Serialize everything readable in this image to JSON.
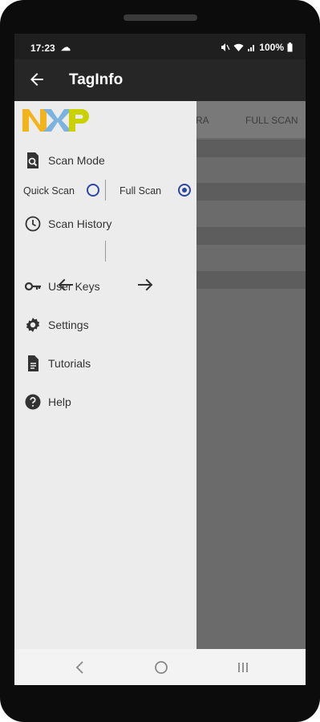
{
  "status_bar": {
    "time": "17:23",
    "battery": "100%",
    "icons": [
      "cloud-icon",
      "mute-icon",
      "wifi-icon",
      "signal-icon",
      "battery-icon"
    ]
  },
  "app_bar": {
    "title": "TagInfo",
    "back_icon": "arrow-back-icon"
  },
  "background_tabs": [
    "RA",
    "FULL SCAN"
  ],
  "drawer": {
    "logo_text": "NXP",
    "scan_mode_label": "Scan Mode",
    "quick_scan_label": "Quick Scan",
    "full_scan_label": "Full Scan",
    "selected_scan": "Full Scan",
    "scan_history_label": "Scan History",
    "history_prev_icon": "arrow-left-icon",
    "history_next_icon": "arrow-right-icon",
    "user_keys_label": "User Keys",
    "settings_label": "Settings",
    "tutorials_label": "Tutorials",
    "help_label": "Help"
  },
  "system_nav": [
    "back-icon",
    "home-icon",
    "recents-icon"
  ],
  "colors": {
    "app_bar": "#262626",
    "drawer_bg": "#ececec",
    "radio_accent": "#2d45a3",
    "nxp_yellow": "#f3b41b",
    "nxp_blue": "#7bb3de",
    "nxp_green": "#c9d200"
  }
}
